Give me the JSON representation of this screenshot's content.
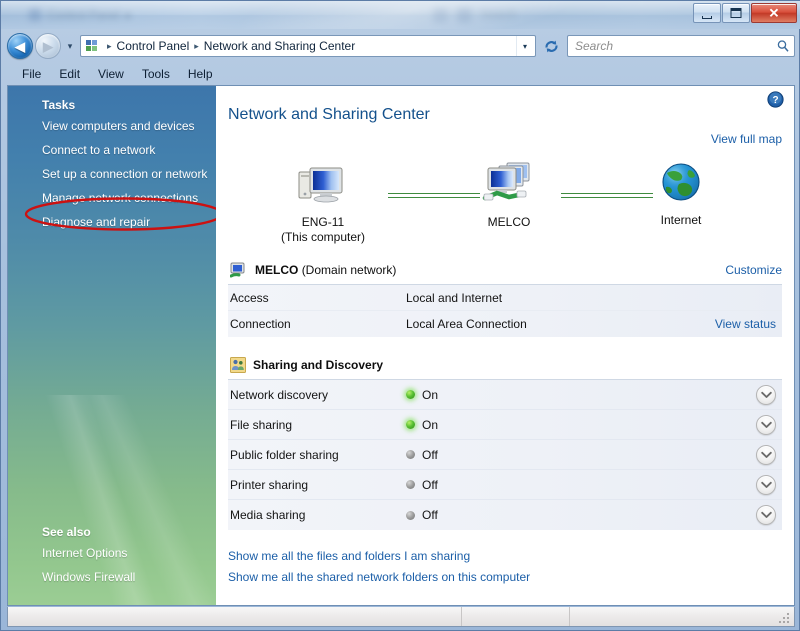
{
  "window": {
    "ghost_title": "Control Panel",
    "buttons": {
      "minimize": "Minimize",
      "maximize": "Maximize",
      "close": "Close",
      "close_glyph": "✕"
    }
  },
  "navigation": {
    "back_label": "Back",
    "back_glyph": "◀",
    "forward_label": "Forward",
    "forward_glyph": "▶",
    "history_glyph": "▾",
    "breadcrumb": [
      "Control Panel",
      "Network and Sharing Center"
    ],
    "breadcrumb_separator": "▸",
    "breadcrumb_dropdown_glyph": "▾",
    "refresh_label": "Refresh",
    "control_panel_icon": "control-panel-icon"
  },
  "search": {
    "placeholder": "Search",
    "value": "",
    "icon": "search-icon"
  },
  "menubar": {
    "items": [
      "File",
      "Edit",
      "View",
      "Tools",
      "Help"
    ]
  },
  "sidebar": {
    "tasks_heading": "Tasks",
    "tasks": [
      "View computers and devices",
      "Connect to a network",
      "Set up a connection or network",
      "Manage network connections",
      "Diagnose and repair"
    ],
    "highlighted_task": "Manage network connections",
    "annotation_color": "#cc1111",
    "see_also_heading": "See also",
    "see_also": [
      "Internet Options",
      "Windows Firewall"
    ]
  },
  "main": {
    "help_label": "Help",
    "help_glyph": "?",
    "page_title": "Network and Sharing Center",
    "view_full_map": "View full map",
    "map": {
      "nodes": [
        {
          "name": "ENG-11",
          "sub": "(This computer)",
          "icon": "computer-icon"
        },
        {
          "name": "MELCO",
          "sub": "",
          "icon": "network-group-icon"
        },
        {
          "name": "Internet",
          "sub": "",
          "icon": "globe-icon"
        }
      ],
      "link_color": "#3f8b3f"
    },
    "network_section": {
      "icon": "network-icon",
      "name": "MELCO",
      "type": "(Domain network)",
      "customize_link": "Customize",
      "rows": [
        {
          "key": "Access",
          "value": "Local and Internet",
          "link": ""
        },
        {
          "key": "Connection",
          "value": "Local Area Connection",
          "link": "View status"
        }
      ]
    },
    "sharing_section": {
      "icon": "sharing-people-icon",
      "title": "Sharing and Discovery",
      "rows": [
        {
          "key": "Network discovery",
          "state": "On",
          "on": true
        },
        {
          "key": "File sharing",
          "state": "On",
          "on": true
        },
        {
          "key": "Public folder sharing",
          "state": "Off",
          "on": false
        },
        {
          "key": "Printer sharing",
          "state": "Off",
          "on": false
        },
        {
          "key": "Media sharing",
          "state": "Off",
          "on": false
        }
      ],
      "expand_glyph": "⌄"
    },
    "bottom_links": [
      "Show me all the files and folders I am sharing",
      "Show me all the shared network folders on this computer"
    ]
  },
  "statusbar": {
    "text": ""
  },
  "colors": {
    "link": "#1c5fa8",
    "title": "#14518c",
    "status_on": "#58c033",
    "status_off": "#9b9b9b"
  }
}
